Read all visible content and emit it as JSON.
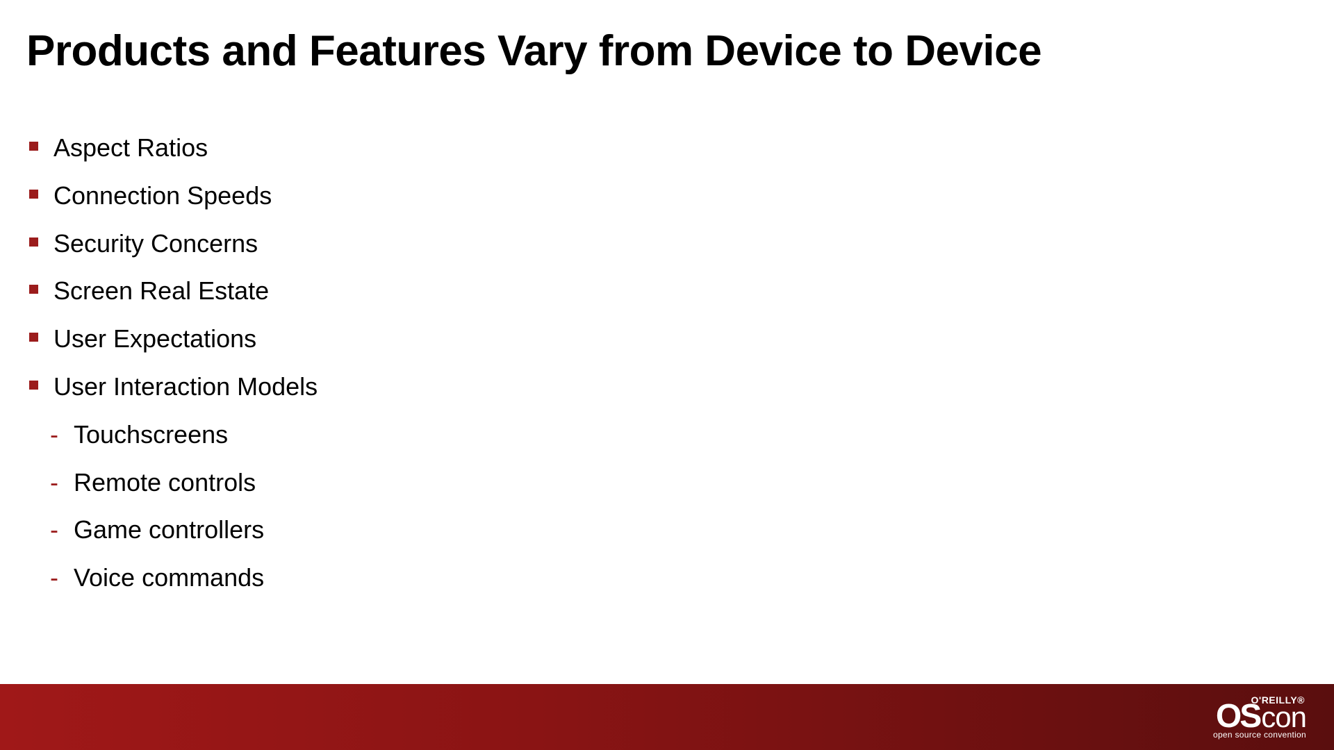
{
  "slide": {
    "title": "Products and Features Vary from Device to Device",
    "bullets": {
      "b0": "Aspect Ratios",
      "b1": "Connection Speeds",
      "b2": "Security Concerns",
      "b3": "Screen Real Estate",
      "b4": "User Expectations",
      "b5": "User Interaction Models"
    },
    "subitems": {
      "s0": "Touchscreens",
      "s1": "Remote controls",
      "s2": "Game controllers",
      "s3": "Voice commands"
    }
  },
  "footer": {
    "oreilly": "O'REILLY®",
    "logo_os": "OS",
    "logo_con": "con",
    "tagline": "open source convention"
  },
  "colors": {
    "accent": "#9b1c1c",
    "footer_gradient_start": "#a01818",
    "footer_gradient_end": "#5a0e0e"
  }
}
